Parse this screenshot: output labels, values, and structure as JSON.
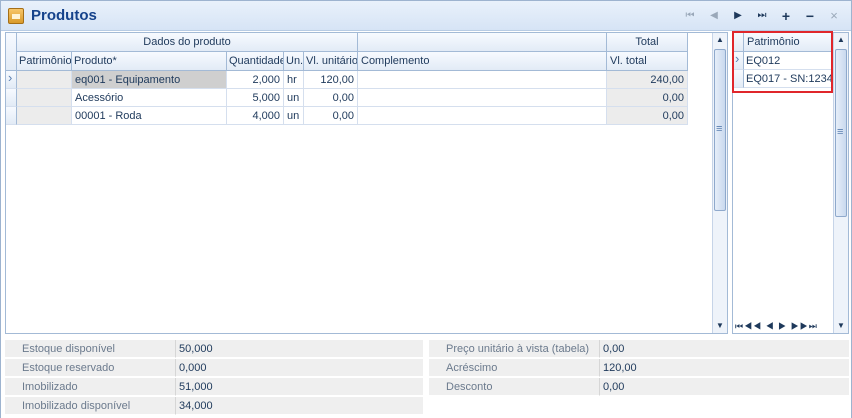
{
  "window": {
    "title": "Produtos",
    "nav": [
      "⏮",
      "◀",
      "▶",
      "⏭",
      "+",
      "−",
      "×"
    ]
  },
  "grid": {
    "band_headers": [
      "Dados do produto",
      "Total"
    ],
    "columns": [
      "Patrimônio",
      "Produto*",
      "Quantidade",
      "Un.",
      "Vl. unitário",
      "Complemento",
      "Vl. total"
    ],
    "rows": [
      {
        "patrimonio": "",
        "produto": "eq001 - Equipamento",
        "quantidade": "2,000",
        "un": "hr",
        "vl_unitario": "120,00",
        "complemento": "",
        "vl_total": "240,00"
      },
      {
        "patrimonio": "",
        "produto": "Acessório",
        "quantidade": "5,000",
        "un": "un",
        "vl_unitario": "0,00",
        "complemento": "",
        "vl_total": "0,00"
      },
      {
        "patrimonio": "",
        "produto": "00001 - Roda",
        "quantidade": "4,000",
        "un": "un",
        "vl_unitario": "0,00",
        "complemento": "",
        "vl_total": "0,00"
      }
    ]
  },
  "patrimonio_grid": {
    "header": "Patrimônio",
    "rows": [
      "EQ012",
      "EQ017 - SN:1234"
    ],
    "nav": "⏮◀◀ ◀ ▶ ▶▶⏭"
  },
  "summary": {
    "left": [
      {
        "label": "Estoque disponível",
        "value": "50,000"
      },
      {
        "label": "Estoque reservado",
        "value": "0,000"
      },
      {
        "label": "Imobilizado",
        "value": "51,000"
      },
      {
        "label": "Imobilizado disponível",
        "value": "34,000"
      }
    ],
    "right": [
      {
        "label": "Preço unitário à vista (tabela)",
        "value": "0,00"
      },
      {
        "label": "Acréscimo",
        "value": "120,00"
      },
      {
        "label": "Desconto",
        "value": "0,00"
      }
    ]
  },
  "colors": {
    "accent": "#15428b",
    "highlight": "#e0262b"
  }
}
